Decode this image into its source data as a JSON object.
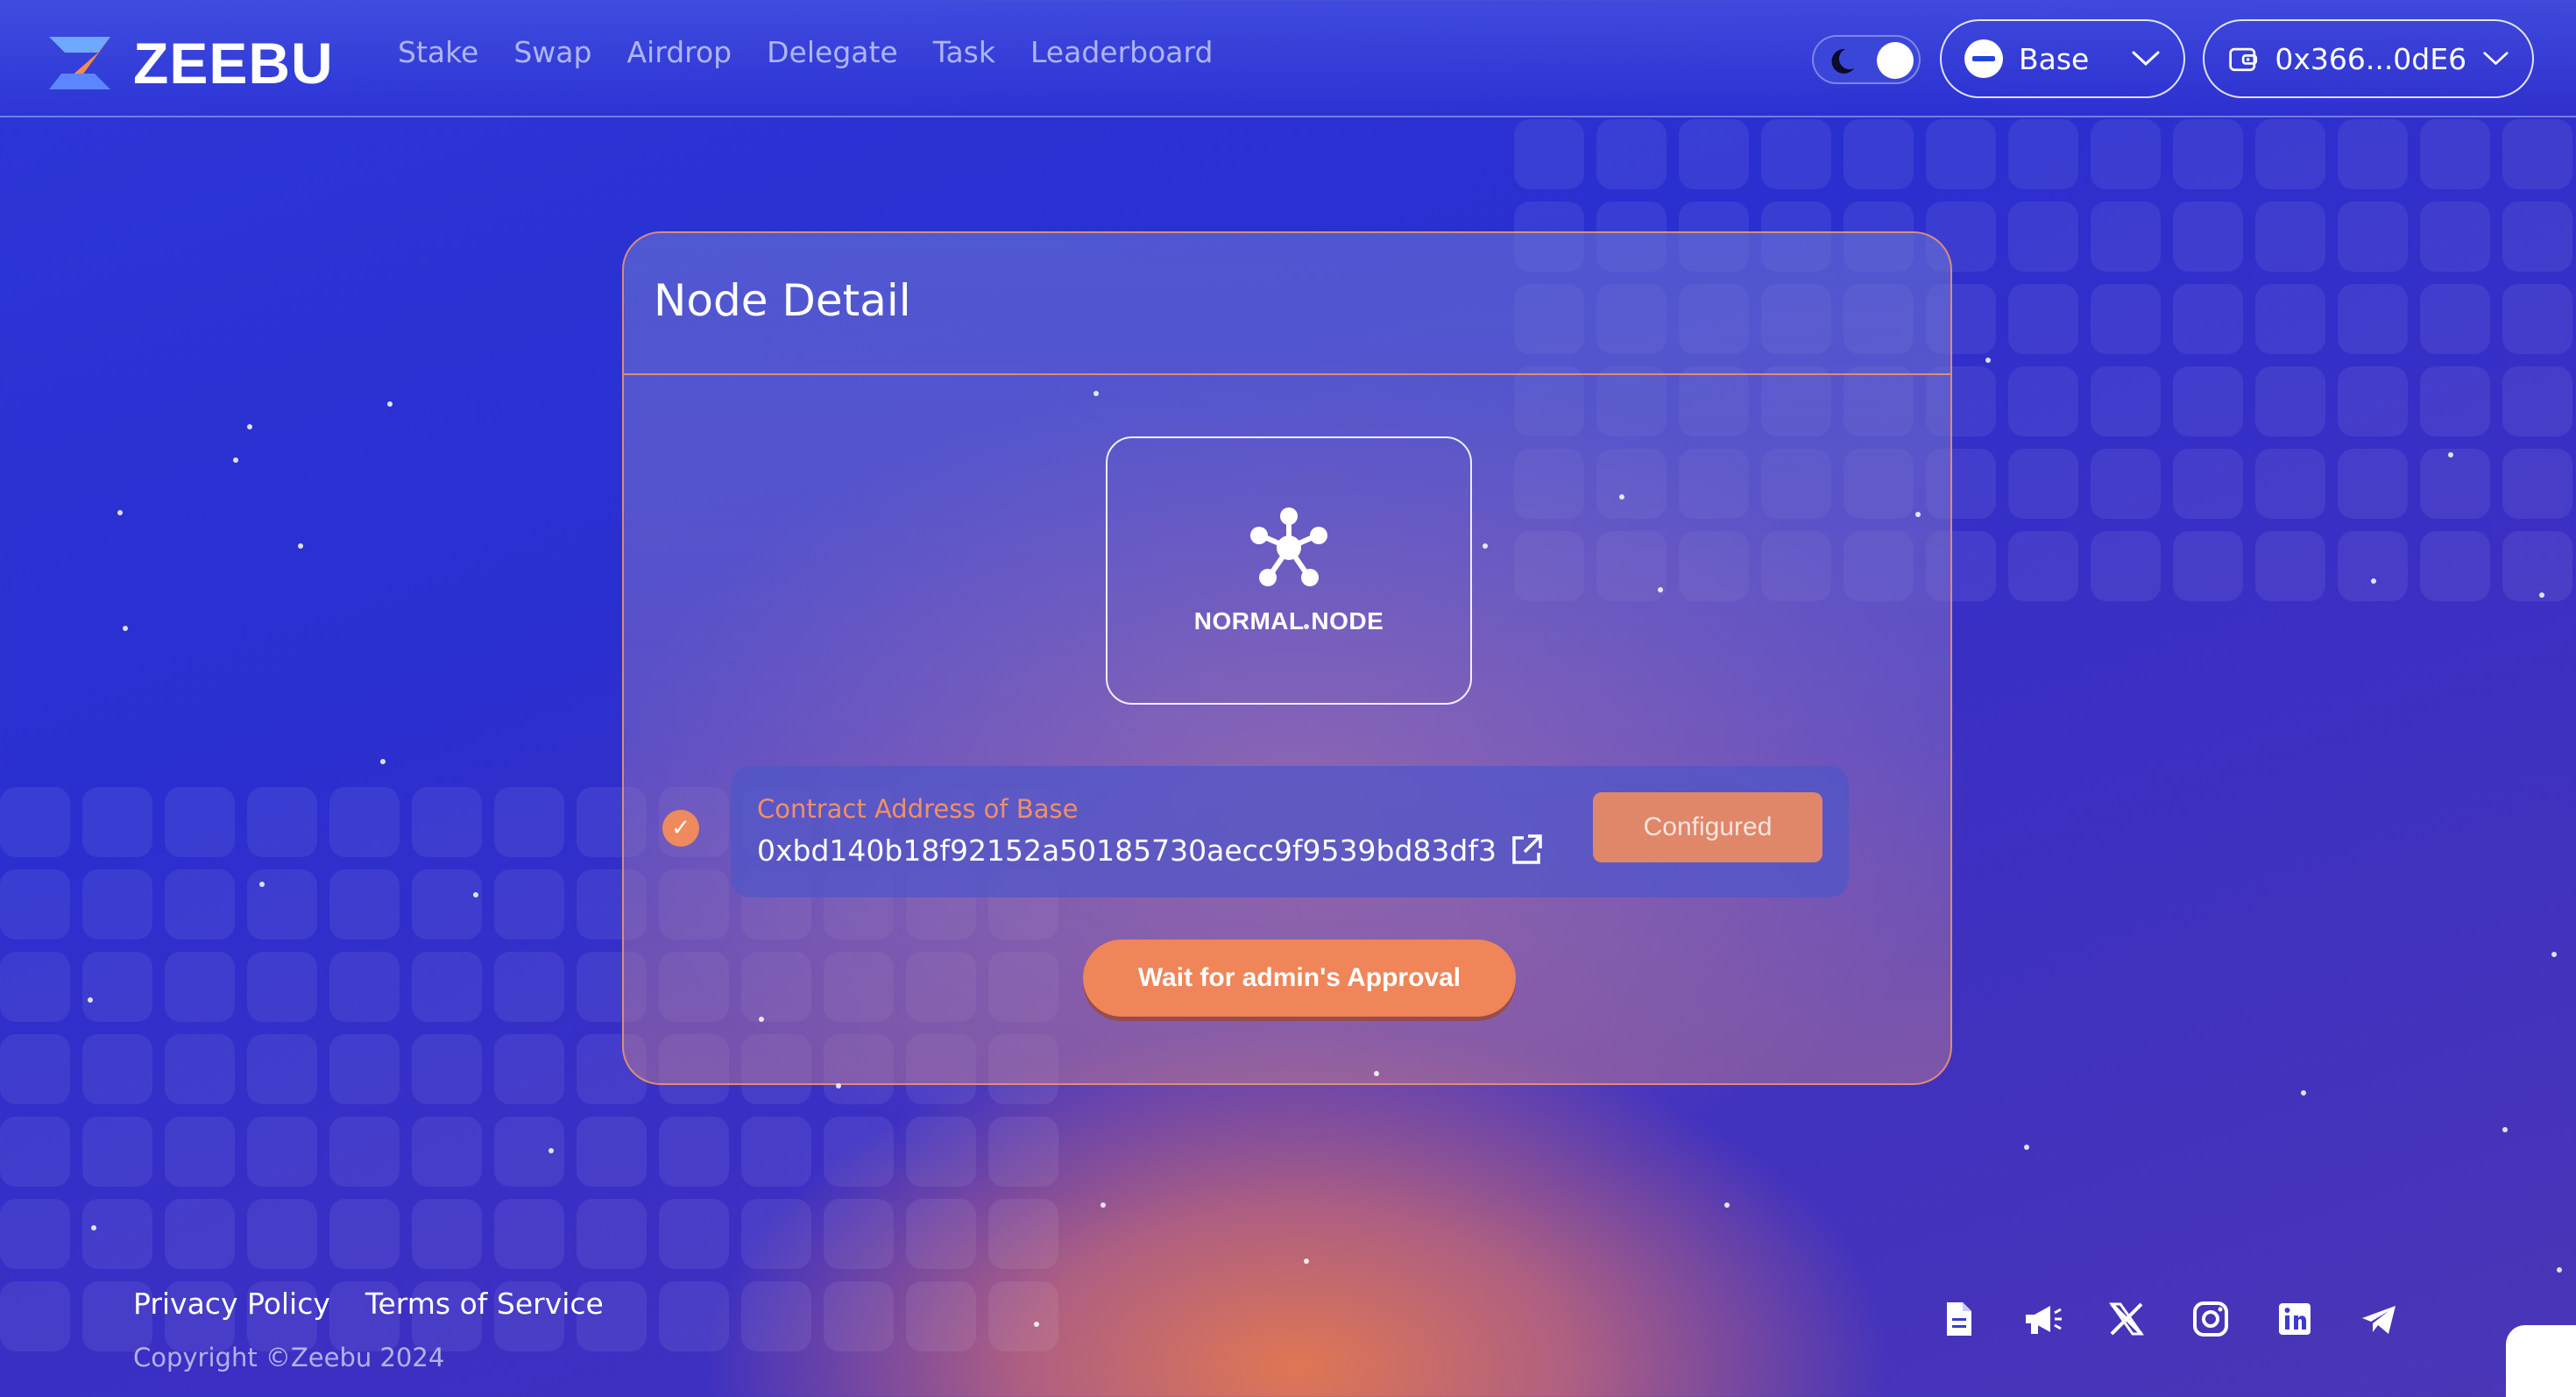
{
  "header": {
    "brand": "ZEEBU",
    "nav": [
      "Stake",
      "Swap",
      "Airdrop",
      "Delegate",
      "Task",
      "Leaderboard"
    ],
    "network": "Base",
    "wallet": "0x366...0dE6",
    "theme": "dark"
  },
  "card": {
    "title": "Node Detail",
    "node_type": "NORMAL NODE",
    "contract_label": "Contract Address of Base",
    "contract_address": "0xbd140b18f92152a50185730aecc9f9539bd83df3",
    "status_button": "Configured",
    "action_button": "Wait for admin's Approval"
  },
  "footer": {
    "privacy": "Privacy Policy",
    "terms": "Terms of Service",
    "copyright": "Copyright ©Zeebu 2024",
    "social_icons": [
      "document-icon",
      "megaphone-icon",
      "x-icon",
      "instagram-icon",
      "linkedin-icon",
      "telegram-icon"
    ]
  },
  "colors": {
    "accent": "#ef8559",
    "background_blue": "#2c36d6",
    "contract_label": "#f19066"
  }
}
